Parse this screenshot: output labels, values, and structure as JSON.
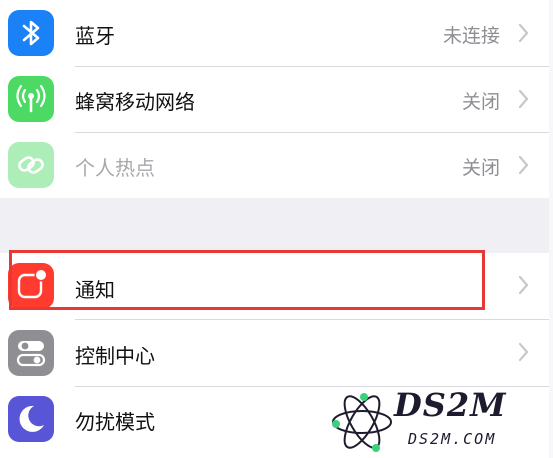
{
  "group1": {
    "rows": [
      {
        "label": "蓝牙",
        "value": "未连接",
        "icon": "bluetooth-icon",
        "icon_color": "#1a82f6"
      },
      {
        "label": "蜂窝移动网络",
        "value": "关闭",
        "icon": "cellular-antenna-icon",
        "icon_color": "#4cd964"
      },
      {
        "label": "个人热点",
        "value": "关闭",
        "icon": "personal-hotspot-icon",
        "icon_color": "#4cd964",
        "dimmed": true
      }
    ]
  },
  "group2": {
    "rows": [
      {
        "label": "通知",
        "value": "",
        "icon": "notifications-icon",
        "icon_color": "#ff3b30",
        "highlighted": true,
        "highlight_color": "#e53935"
      },
      {
        "label": "控制中心",
        "value": "",
        "icon": "control-center-icon",
        "icon_color": "#8e8e93"
      },
      {
        "label": "勿扰模式",
        "value": "",
        "icon": "moon-icon",
        "icon_color": "#5856d6"
      }
    ]
  },
  "watermark": {
    "text": "DS2M",
    "subtext": "DS2M.COM"
  },
  "colors": {
    "background": "#efeff4",
    "secondary_text": "#8e8e93"
  }
}
